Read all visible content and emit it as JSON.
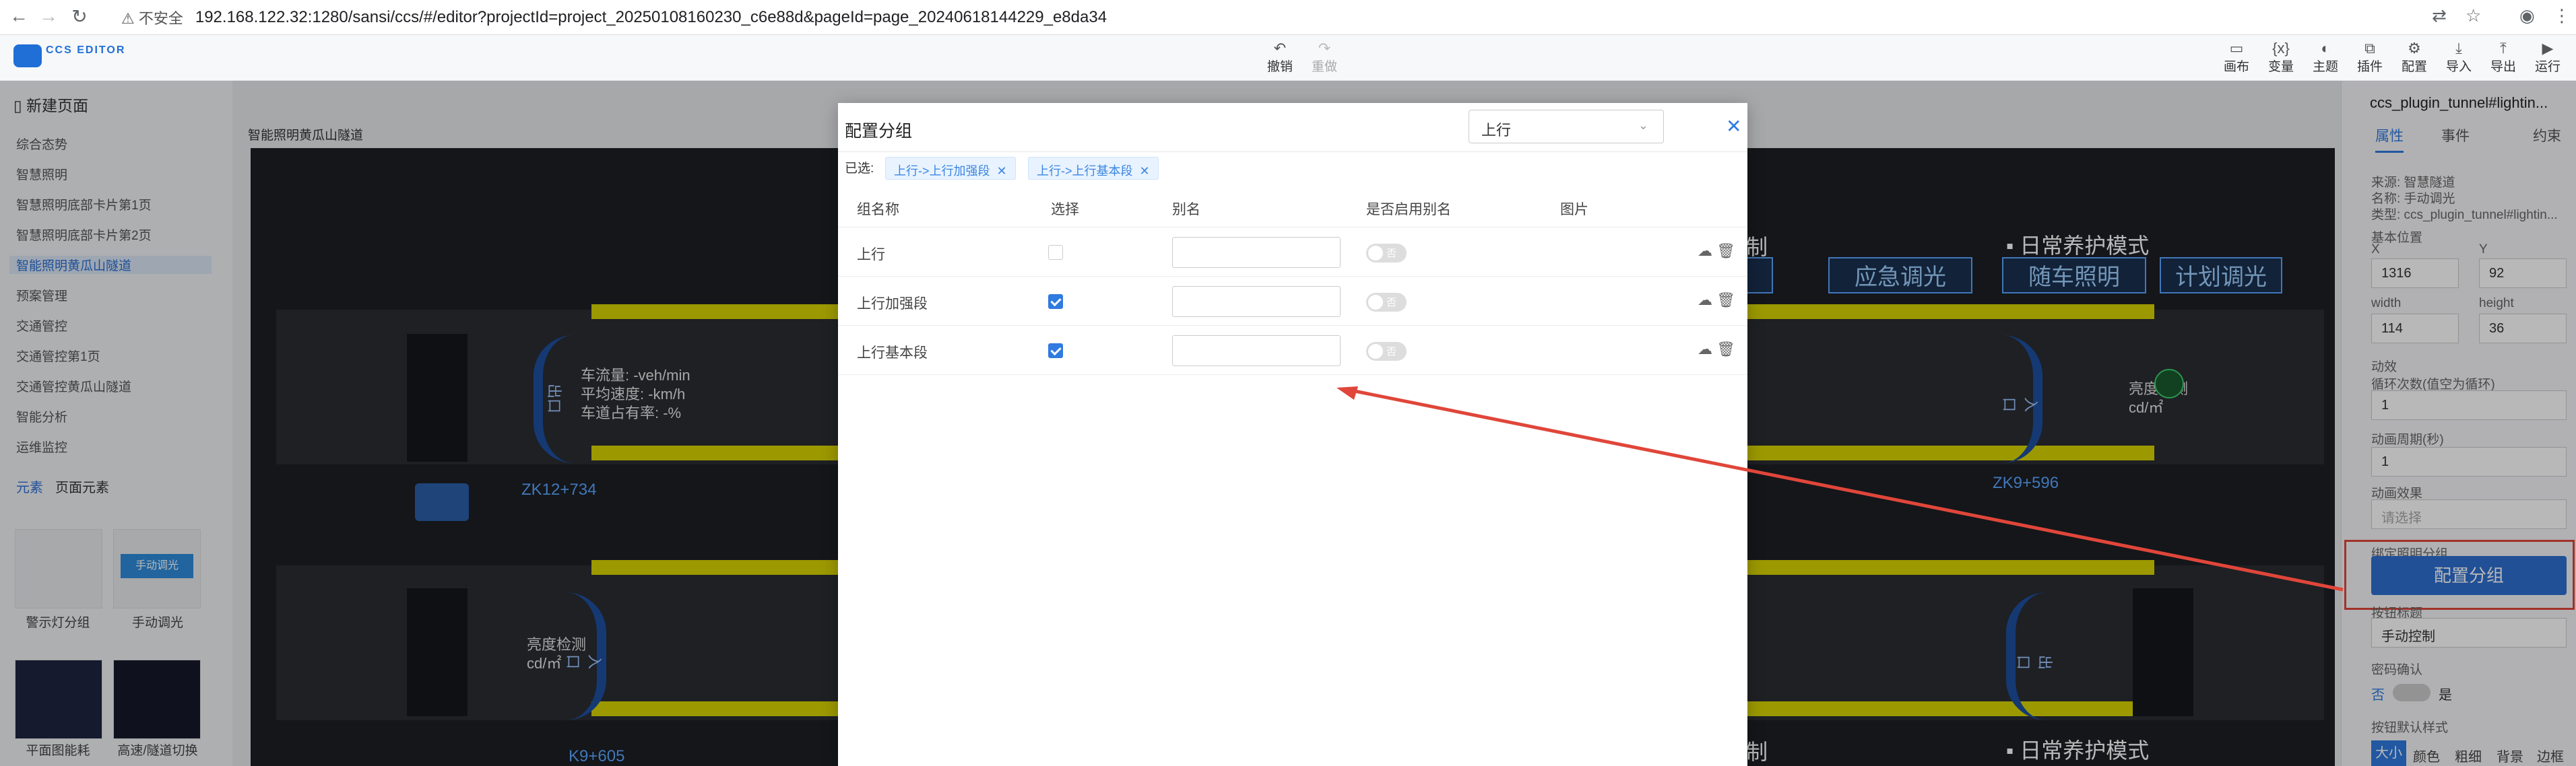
{
  "browser": {
    "security": "不安全",
    "url": "192.168.122.32:1280/sansi/ccs/#/editor?projectId=project_20250108160230_c6e88d&pageId=page_20240618144229_e8da34"
  },
  "app": {
    "logo_text": "CCS EDITOR",
    "undo": "撤销",
    "redo": "重做",
    "toolbar": [
      "画布",
      "变量",
      "主题",
      "插件",
      "配置",
      "导入",
      "导出",
      "运行"
    ]
  },
  "left_panel": {
    "new_page": "新建页面",
    "pages": [
      "综合态势",
      "智慧照明",
      "智慧照明底部卡片第1页",
      "智慧照明底部卡片第2页",
      "智能照明黄瓜山隧道",
      "预案管理",
      "交通管控",
      "交通管控第1页",
      "交通管控黄瓜山隧道",
      "智能分析",
      "运维监控"
    ],
    "selected_page_index": 4,
    "tabs": [
      "元素",
      "页面元素"
    ],
    "components": [
      "警示灯分组",
      "手动调光",
      "平面图能耗",
      "高速/隧道切换"
    ],
    "comp_button_label": "手动调光"
  },
  "canvas": {
    "title": "智能照明黄瓜山隧道",
    "stake_left_top": "ZK12+734",
    "stake_right_top": "ZK9+596",
    "stake_left_bottom": "K9+605",
    "traffic_flow": "车流量: -veh/min",
    "avg_speed": "平均速度: -km/h",
    "occupancy": "车道占有率: -%",
    "brightness": "亮度检测",
    "brightness_unit": "cd/㎡",
    "mode_title": "日常养护模式",
    "btn_emergency": "应急调光",
    "btn_follow": "随车照明",
    "btn_plan": "计划调光",
    "partial_ctrl": "制",
    "lane_marks": [
      "出口",
      "入口",
      "入口",
      "出口"
    ]
  },
  "modal": {
    "title": "配置分组",
    "direction_select": "上行",
    "selected_label": "已选:",
    "tags": [
      "上行->上行加强段",
      "上行->上行基本段"
    ],
    "columns": [
      "组名称",
      "选择",
      "别名",
      "是否启用别名",
      "图片"
    ],
    "rows": [
      {
        "name": "上行",
        "checked": false,
        "switch": "否"
      },
      {
        "name": "上行加强段",
        "checked": true,
        "switch": "否"
      },
      {
        "name": "上行基本段",
        "checked": true,
        "switch": "否"
      }
    ]
  },
  "right_panel": {
    "component_name": "ccs_plugin_tunnel#lightin...",
    "tabs": [
      "属性",
      "事件",
      "约束"
    ],
    "source": "来源: 智慧隧道",
    "name": "名称: 手动调光",
    "type": "类型: ccs_plugin_tunnel#lightin...",
    "base_position": "基本位置",
    "x_label": "X",
    "y_label": "Y",
    "x": "1316",
    "y": "92",
    "width_label": "width",
    "height_label": "height",
    "width": "114",
    "height": "36",
    "anim": "动效",
    "loop_label": "循环次数(值空为循环)",
    "loop": "1",
    "period_label": "动画周期(秒)",
    "period": "1",
    "effect_label": "动画效果",
    "effect_placeholder": "请选择",
    "bind_group_label": "绑定照明分组",
    "config_btn": "配置分组",
    "button_title_label": "按钮标题",
    "button_title": "手动控制",
    "password_label": "密码确认",
    "no": "否",
    "yes": "是",
    "default_style_label": "按钮默认样式",
    "style_tabs": [
      "大小",
      "颜色",
      "粗细",
      "背景",
      "边框"
    ]
  },
  "colors": {
    "accent": "#2f7be0",
    "arrow": "#e0463a",
    "tunnel_bg": "#1d1f24",
    "lane_yellow": "#d9d400"
  }
}
